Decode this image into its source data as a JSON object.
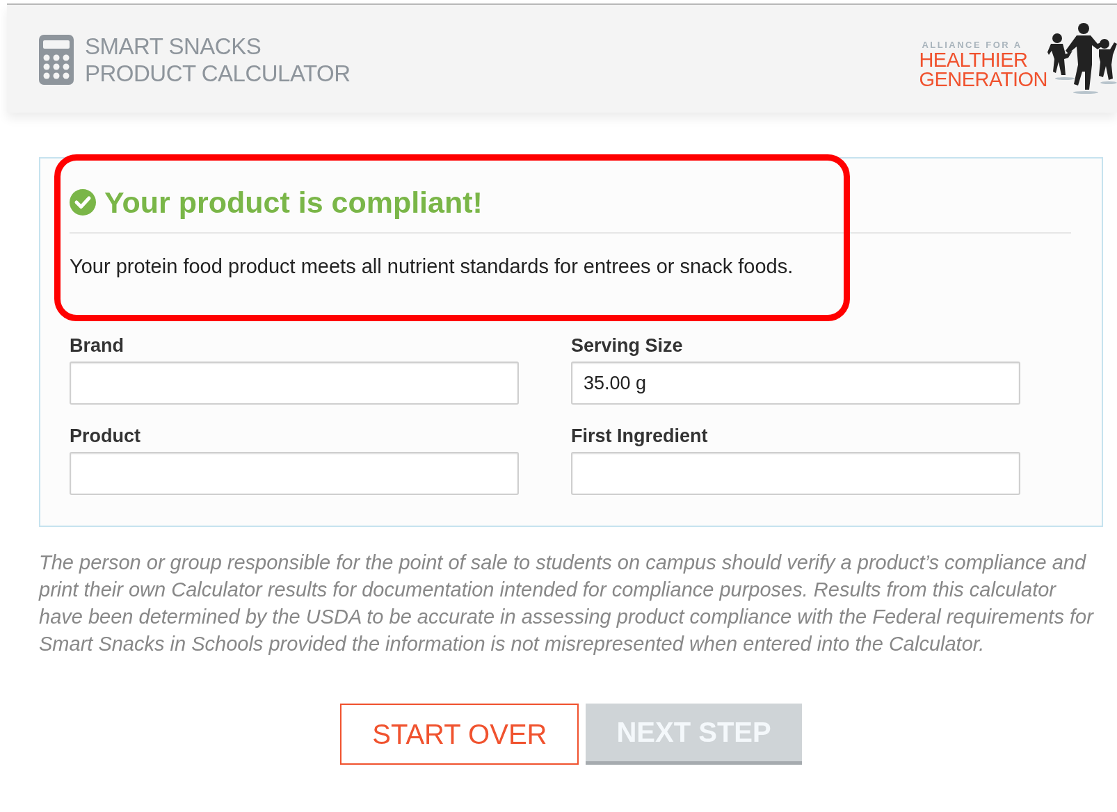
{
  "header": {
    "title_lines": [
      "SMART SNACKS",
      "PRODUCT CALCULATOR"
    ],
    "logo": {
      "tagline": "ALLIANCE FOR A",
      "name_lines": [
        "HEALTHIER",
        "GENERATION"
      ]
    }
  },
  "result": {
    "compliant": true,
    "title": "Your product is compliant!",
    "message": "Your protein food product meets all nutrient standards for entrees or snack foods.",
    "highlighted": true
  },
  "fields": [
    {
      "label": "Brand"
    },
    {
      "label": "Serving Size",
      "value": "35.00 g"
    },
    {
      "label": "Product"
    },
    {
      "label": "First Ingredient"
    }
  ],
  "disclaimer": "The person or group responsible for the point of sale to students on campus should verify a product’s compliance and print their own Calculator results for documentation intended for compliance purposes. Results from this calculator have been determined by the USDA to be accurate in assessing product compliance with the Federal requirements for Smart Snacks in Schools provided the information is not misrepresented when entered into the Calculator.",
  "buttons": [
    {
      "kind": "secondary",
      "label": "START OVER",
      "disabled": false
    },
    {
      "kind": "primary",
      "label": "NEXT STEP",
      "disabled": true
    }
  ]
}
